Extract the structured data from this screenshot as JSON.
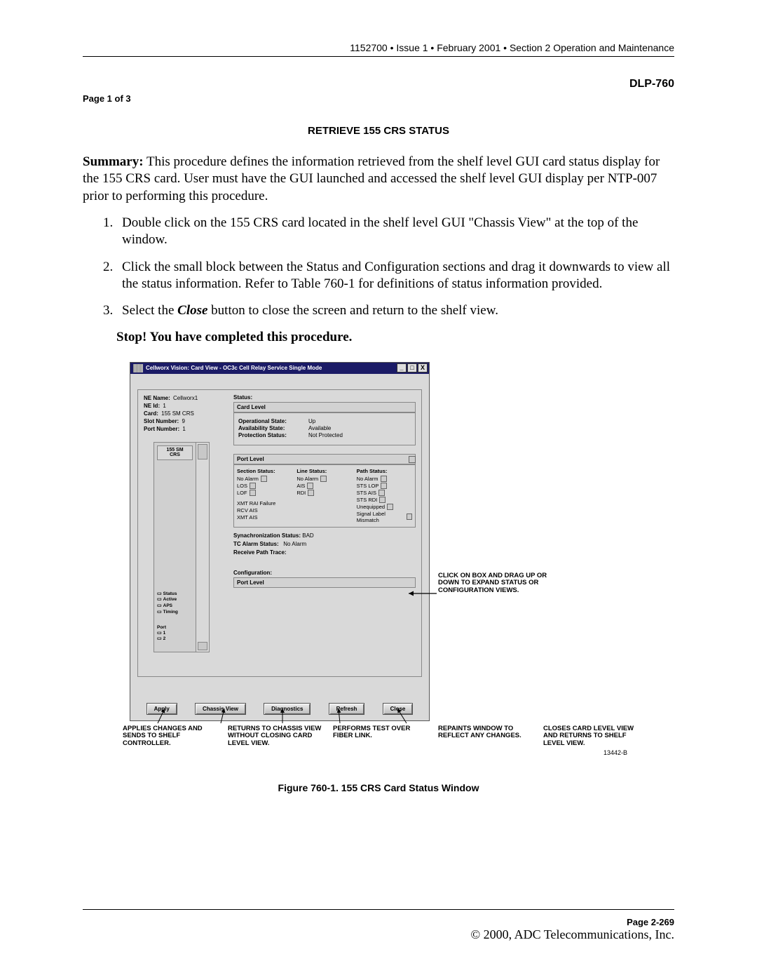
{
  "header": {
    "running": "1152700 • Issue 1 • February 2001 • Section 2 Operation and Maintenance",
    "dlp": "DLP-760",
    "pageof": "Page 1 of 3"
  },
  "title": "RETRIEVE 155 CRS STATUS",
  "summary_label": "Summary:",
  "summary_text": "This procedure defines the information retrieved from the shelf level GUI card status display for the 155 CRS card. User must have the GUI launched and accessed the shelf level GUI display per NTP-007 prior to performing this procedure.",
  "steps": [
    "Double click on the 155 CRS card located in the shelf level GUI \"Chassis View\" at the top of the window.",
    "Click the small block between the Status and Configuration sections and drag it downwards to view all the status information. Refer to Table 760-1 for definitions of status information provided.",
    "Select the Close button to close the screen and return to the shelf view."
  ],
  "close_word": "Close",
  "stop": "Stop! You have completed this procedure.",
  "window": {
    "title": "Cellworx Vision:   Card View - OC3c Cell Relay Service Single Mode",
    "minimize": "_",
    "maximize": "□",
    "close": "X",
    "info": {
      "ne_name_k": "NE Name:",
      "ne_name_v": "Cellworx1",
      "ne_id_k": "NE Id:",
      "ne_id_v": "1",
      "card_k": "Card:",
      "card_v": "155 SM CRS",
      "slot_k": "Slot Number:",
      "slot_v": "9",
      "port_k": "Port Number:",
      "port_v": "1"
    },
    "card_label": "155 SM\nCRS",
    "leds": [
      "Status",
      "Active",
      "APS",
      "Timing"
    ],
    "port_hdr": "Port",
    "ports": [
      "1",
      "2"
    ],
    "status_label": "Status:",
    "card_level": "Card Level",
    "card_fields": {
      "op_k": "Operational State:",
      "op_v": "Up",
      "av_k": "Availability State:",
      "av_v": "Available",
      "pr_k": "Protection Status:",
      "pr_v": "Not Protected"
    },
    "port_level": "Port Level",
    "sec_hdr": "Section Status:",
    "line_hdr": "Line Status:",
    "path_hdr": "Path Status:",
    "sec_items": [
      "No Alarm",
      "LOS",
      "LOF"
    ],
    "line_items": [
      "No Alarm",
      "AIS",
      "RDI"
    ],
    "path_items": [
      "No Alarm",
      "STS LOP",
      "STS AIS",
      "STS RDI",
      "Unequipped",
      "Signal Label Mismatch"
    ],
    "extra_items": [
      "XMT RAI Failure",
      "RCV AIS",
      "XMT AIS"
    ],
    "sync_k": "Synachronization Status:",
    "sync_v": "BAD",
    "tc_k": "TC Alarm Status:",
    "tc_v": "No Alarm",
    "rcv_path": "Receive Path Trace:",
    "conf_label": "Configuration:",
    "conf_port": "Port Level",
    "buttons": [
      "Apply",
      "Chassis View",
      "Diagnostics",
      "Refresh",
      "Close"
    ]
  },
  "callouts": {
    "drag": "CLICK ON BOX AND DRAG UP OR DOWN TO EXPAND STATUS OR CONFIGURATION VIEWS.",
    "apply": "APPLIES CHANGES AND SENDS TO SHELF CONTROLLER.",
    "chassis": "RETURNS TO CHASSIS VIEW WITHOUT CLOSING CARD LEVEL VIEW.",
    "diag": "PERFORMS TEST OVER FIBER LINK.",
    "refresh": "REPAINTS WINDOW TO REFLECT ANY CHANGES.",
    "close": "CLOSES CARD LEVEL VIEW AND RETURNS TO SHELF LEVEL VIEW.",
    "figid": "13442-B"
  },
  "caption": "Figure 760-1. 155 CRS Card Status Window",
  "footer": {
    "page": "Page 2-269",
    "copyright": "© 2000, ADC Telecommunications, Inc."
  }
}
